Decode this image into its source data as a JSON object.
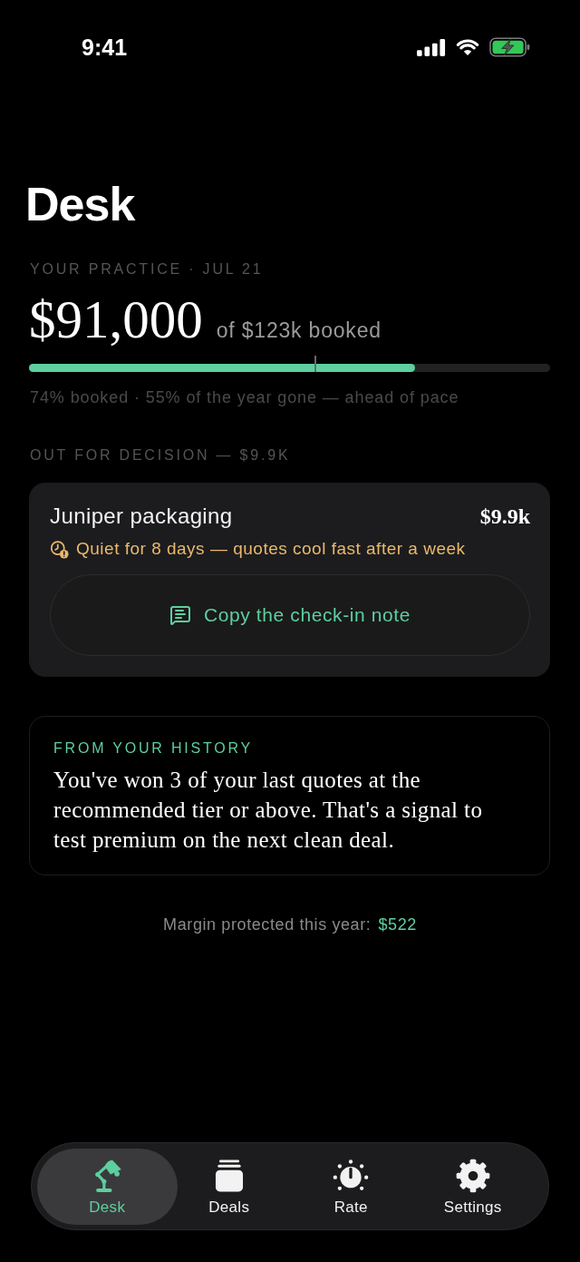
{
  "status_bar": {
    "time": "9:41"
  },
  "header": {
    "title": "Desk"
  },
  "practice": {
    "eyebrow": "YOUR PRACTICE · JUL 21",
    "amount": "$91,000",
    "amount_note": "of $123k booked",
    "progress": {
      "level": 0.74,
      "marker": {
        "level": 0.55
      }
    },
    "caption": "74% booked · 55% of the year gone — ahead of pace"
  },
  "decision": {
    "heading": "OUT FOR DECISION — $9.9K",
    "deals": [
      {
        "name": "Juniper packaging",
        "value": "$9.9k",
        "alert": "Quiet for 8 days — quotes cool fast after a week",
        "action": "Copy the check-in note"
      }
    ]
  },
  "insight": {
    "eyebrow": "FROM YOUR HISTORY",
    "body": "You've won 3 of your last quotes at the recommended tier or above. That's a signal to test premium on the next clean deal."
  },
  "margin": {
    "label": "Margin protected this year:",
    "value": "$522"
  },
  "tab_bar": {
    "tabs": [
      {
        "label": "Desk",
        "kind": "lamp",
        "selected": true
      },
      {
        "label": "Deals",
        "kind": "stack",
        "selected": false
      },
      {
        "label": "Rate",
        "kind": "dial",
        "selected": false
      },
      {
        "label": "Settings",
        "kind": "gear",
        "selected": false
      }
    ]
  }
}
